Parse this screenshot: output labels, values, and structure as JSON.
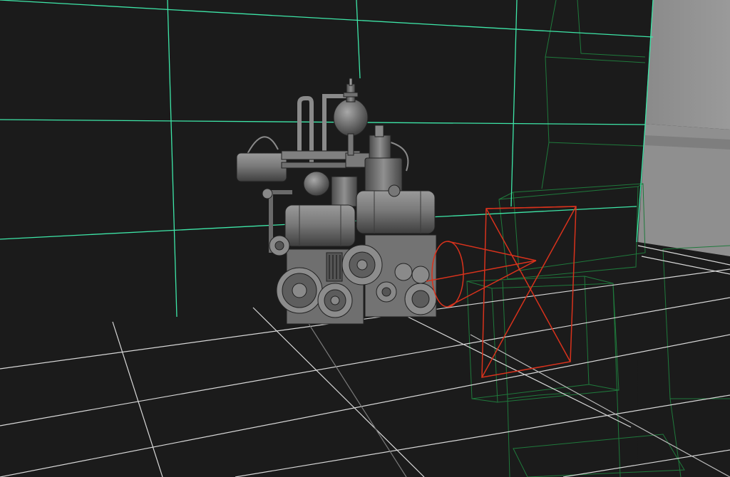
{
  "viewport": {
    "kind": "3d-perspective-viewport",
    "display_mode": "smooth-shaded-with-wireframe",
    "background_color": "#1b1b1b",
    "colors": {
      "ground_grid": "#d8d8d8",
      "backdrop_grid": "#3ee6a8",
      "camera_frustum": "#d8321c",
      "wireframe_boxes": "#1f7a3c",
      "side_wall": "#8d8d8d",
      "model_shade": "#7c7c7c"
    },
    "objects": [
      {
        "name": "steam-engine-machine",
        "type": "mesh",
        "selected": false
      },
      {
        "name": "camera-frustum",
        "type": "camera",
        "selected": true
      },
      {
        "name": "backdrop-grid-plane",
        "type": "grid",
        "selected": false
      },
      {
        "name": "ground-grid",
        "type": "grid",
        "selected": false
      },
      {
        "name": "wireframe-boxes",
        "type": "mesh-wireframe",
        "selected": false
      },
      {
        "name": "side-wall",
        "type": "mesh",
        "selected": false
      }
    ]
  }
}
